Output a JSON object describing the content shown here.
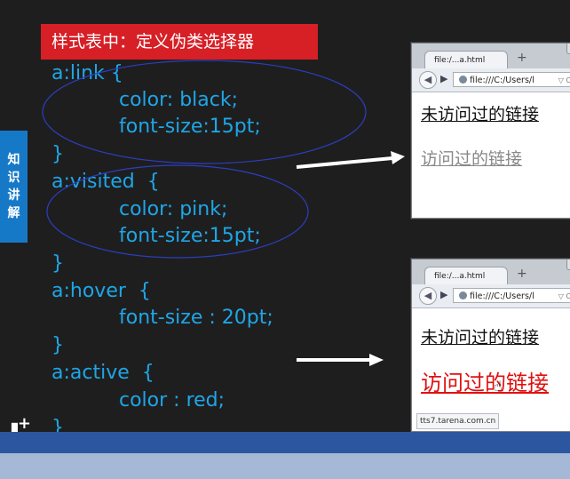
{
  "heading": "样式表中：定义伪类选择器",
  "side_tab": [
    "知",
    "识",
    "讲",
    "解"
  ],
  "code": {
    "link_selector": "a:link {",
    "link_color": "color: black;",
    "link_size": "font-size:15pt;",
    "close1": "}",
    "visited_selector": "a:visited  {",
    "visited_color": "color: pink;",
    "visited_size": "font-size:15pt;",
    "close2": "}",
    "hover_selector": "a:hover  {",
    "hover_size": "font-size : 20pt;",
    "close3": "}",
    "active_selector": "a:active  {",
    "active_color": "color : red;",
    "close4": "}"
  },
  "browser1": {
    "tab_title": "file:/...a.html",
    "new_tab": "+",
    "url": "file:///C:/Users/l",
    "link_unvisited": "未访问过的链接",
    "link_visited": "访问过的链接"
  },
  "browser2": {
    "tab_title": "file:/...a.html",
    "new_tab": "+",
    "url": "file:///C:/Users/l",
    "link_unvisited": "未访问过的链接",
    "link_hover": "访问过的链接",
    "status": "tts7.tarena.com.cn"
  },
  "colors": {
    "code": "#1ea6e8",
    "heading_bg": "#d71f26",
    "side_tab_bg": "#1679c8",
    "link_black": "#111111",
    "link_visited": "#888888",
    "link_active": "#e01010"
  }
}
